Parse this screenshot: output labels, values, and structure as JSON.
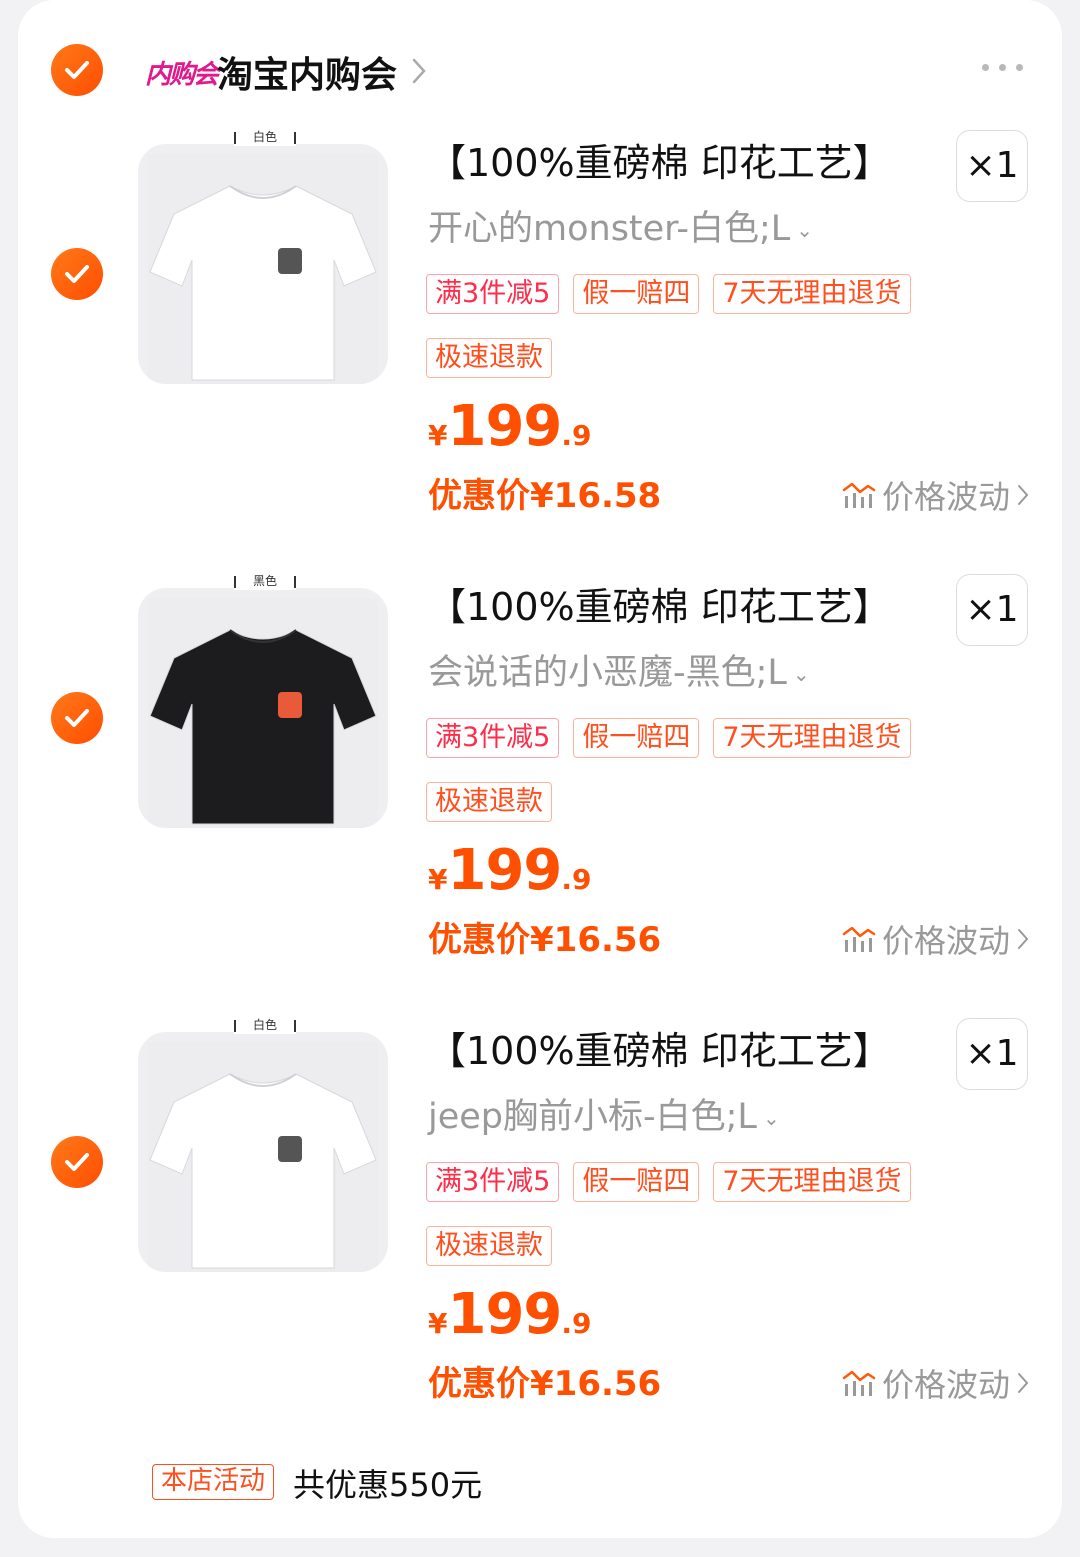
{
  "shop": {
    "logo_text": "内购会",
    "name": "淘宝内购会"
  },
  "items": [
    {
      "image_label": "白色",
      "shirt_color": "#ffffff",
      "title": "【100%重磅棉  印花工艺】",
      "quantity": "×1",
      "variant": "开心的monster-白色;L",
      "tags": [
        "满3件减5",
        "假一赔四",
        "7天无理由退货",
        "极速退款"
      ],
      "price_currency": "¥",
      "price_int": "199",
      "price_dec": ".9",
      "promo_price": "优惠价¥16.58",
      "trend_label": "价格波动"
    },
    {
      "image_label": "黑色",
      "shirt_color": "#1c1c1e",
      "title": "【100%重磅棉  印花工艺】",
      "quantity": "×1",
      "variant": "会说话的小恶魔-黑色;L",
      "tags": [
        "满3件减5",
        "假一赔四",
        "7天无理由退货",
        "极速退款"
      ],
      "price_currency": "¥",
      "price_int": "199",
      "price_dec": ".9",
      "promo_price": "优惠价¥16.56",
      "trend_label": "价格波动"
    },
    {
      "image_label": "白色",
      "shirt_color": "#ffffff",
      "title": "【100%重磅棉  印花工艺】",
      "quantity": "×1",
      "variant": "jeep胸前小标-白色;L",
      "tags": [
        "满3件减5",
        "假一赔四",
        "7天无理由退货",
        "极速退款"
      ],
      "price_currency": "¥",
      "price_int": "199",
      "price_dec": ".9",
      "promo_price": "优惠价¥16.56",
      "trend_label": "价格波动"
    }
  ],
  "footer": {
    "badge": "本店活动",
    "summary": "共优惠550元"
  },
  "colors": {
    "accent": "#ff4f00",
    "check": "#ff5a0a",
    "tag_red": "#ff2d4a"
  }
}
